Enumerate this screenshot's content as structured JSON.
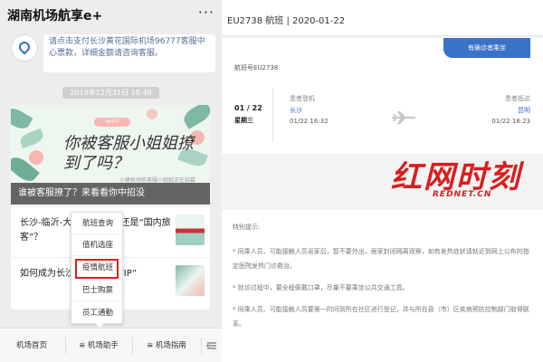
{
  "left": {
    "title": "湖南机场航享e+",
    "more": "···",
    "message": "请点击支付长沙黄花国际机场96777客服中心票款，详细金额请咨询客服。",
    "timestamp": "2019年12月31日 18:48",
    "article": {
      "banner_badge": "Vol??",
      "banner_handwrite": "你被客服小姐姐撩到了吗？",
      "banner_small": "小撩机场航客服小姐姐正在招募",
      "caption": "谁被客服撩了？来看看你中招没"
    },
    "rows": [
      {
        "text": "长沙-临沂-大连 ... 旅客” 还是“国内旅客”？"
      },
      {
        "text": "如何成为长沙 ... 的 “VVVIP”"
      }
    ],
    "popup_menu": {
      "items": [
        "航班查询",
        "值机选座",
        "疫情航班",
        "巴士购票",
        "员工通勤"
      ],
      "highlighted_index": 2
    },
    "bottom_menu": {
      "items": [
        "机场首页",
        "≡ 机场助手",
        "≡ 机场指南"
      ],
      "keyboard_icon": "keyboard-icon"
    }
  },
  "right": {
    "title": "EU2738 航班 | 2020-01-22",
    "patient_tag": "有确诊者乘坐",
    "flight_no": "航班号EU2738",
    "date": "01 / 22",
    "weekday": "星期三",
    "departure": {
      "label": "患者登机",
      "city": "长沙",
      "time": "01/22 16:32"
    },
    "arrival": {
      "label": "患者抵达",
      "city": "昆明",
      "time": "01/22 18:23"
    },
    "notice_title": "特别提示:",
    "notices": [
      "* 同乘人员、可能接触人员返家后，暂不要外出，居家封闭隔离观察，如有发热症状请就近到网上公布的指定医院发热门诊救治。",
      "* 就诊过程中，要全程佩戴口罩，尽量不要乘坐公共交通工具。",
      "* 同乘人员、可能接触人员要第一时间到所在社区进行登记，并与所在县（市）区疾病预防控制部门取得联系。"
    ]
  },
  "watermark": {
    "main": "红网时刻",
    "sub": "REDNET.CN"
  },
  "colors": {
    "accent_blue": "#3b72c7",
    "highlight_red": "#e02020",
    "watermark_red": "#d81e1e",
    "link_blue": "#576b95"
  }
}
